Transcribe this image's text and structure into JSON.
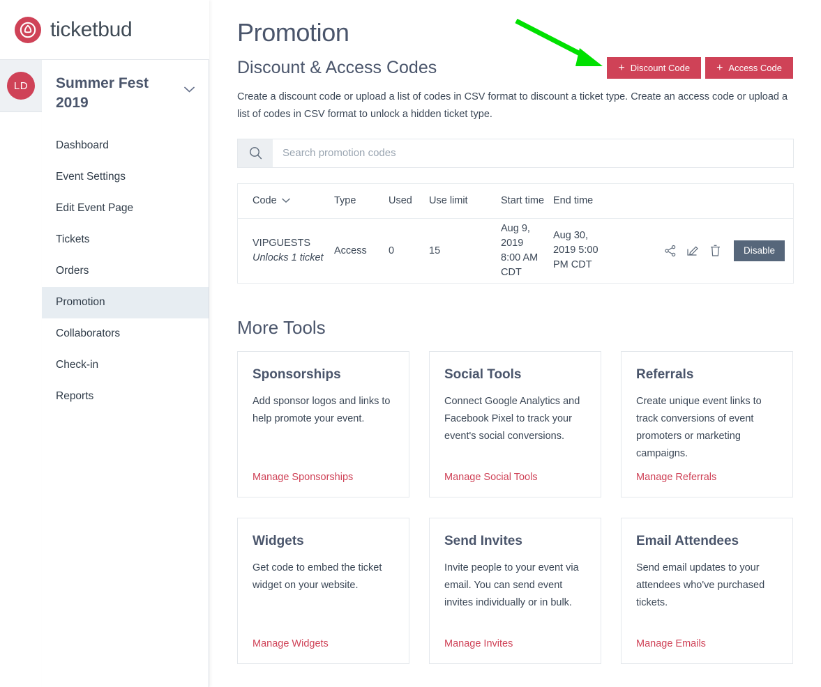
{
  "brand": {
    "wordmark": "ticketbud",
    "logo_icon": "ticketbud-logo-icon",
    "accent_color": "#cf4257"
  },
  "user": {
    "avatar_initials": "LD"
  },
  "sidebar": {
    "event_name": "Summer Fest 2019",
    "switcher_icon": "chevron-down-icon",
    "items": [
      {
        "label": "Dashboard",
        "active": false
      },
      {
        "label": "Event Settings",
        "active": false
      },
      {
        "label": "Edit Event Page",
        "active": false
      },
      {
        "label": "Tickets",
        "active": false
      },
      {
        "label": "Orders",
        "active": false
      },
      {
        "label": "Promotion",
        "active": true
      },
      {
        "label": "Collaborators",
        "active": false
      },
      {
        "label": "Check-in",
        "active": false
      },
      {
        "label": "Reports",
        "active": false
      }
    ]
  },
  "main": {
    "page_title": "Promotion",
    "section_title": "Discount & Access Codes",
    "buttons": {
      "discount_code": "Discount Code",
      "access_code": "Access Code",
      "plus_glyph": "+"
    },
    "lede": "Create a discount code or upload a list of codes in CSV format to discount a ticket type. Create an access code or upload a list of codes in CSV format to unlock a hidden ticket type.",
    "search": {
      "placeholder": "Search promotion codes",
      "value": "",
      "icon": "search-icon"
    }
  },
  "table": {
    "columns": [
      "Code",
      "Type",
      "Used",
      "Use limit",
      "Start time",
      "End time"
    ],
    "sort_icon": "chevron-down-icon",
    "rows": [
      {
        "code": "VIPGUESTS",
        "code_note": "Unlocks 1 ticket",
        "type": "Access",
        "used": "0",
        "use_limit": "15",
        "start_time": "Aug 9, 2019 8:00 AM CDT",
        "end_time": "Aug 30, 2019 5:00 PM CDT",
        "actions": [
          "share-icon",
          "edit-icon",
          "trash-icon"
        ],
        "disable_label": "Disable"
      }
    ]
  },
  "more_tools": {
    "heading": "More Tools",
    "cards": [
      {
        "title": "Sponsorships",
        "body": "Add sponsor logos and links to help promote your event.",
        "link": "Manage Sponsorships"
      },
      {
        "title": "Social Tools",
        "body": "Connect Google Analytics and Facebook Pixel to track your event's social conversions.",
        "link": "Manage Social Tools"
      },
      {
        "title": "Referrals",
        "body": "Create unique event links to track conversions of event promoters or marketing campaigns.",
        "link": "Manage Referrals"
      },
      {
        "title": "Widgets",
        "body": "Get code to embed the ticket widget on your website.",
        "link": "Manage Widgets"
      },
      {
        "title": "Send Invites",
        "body": "Invite people to your event via email. You can send event invites individually or in bulk.",
        "link": "Manage Invites"
      },
      {
        "title": "Email Attendees",
        "body": "Send email updates to your attendees who've purchased tickets.",
        "link": "Manage Emails"
      }
    ]
  },
  "annotation": {
    "type": "arrow",
    "color": "#00e000",
    "points_to": "discount-code-button"
  }
}
